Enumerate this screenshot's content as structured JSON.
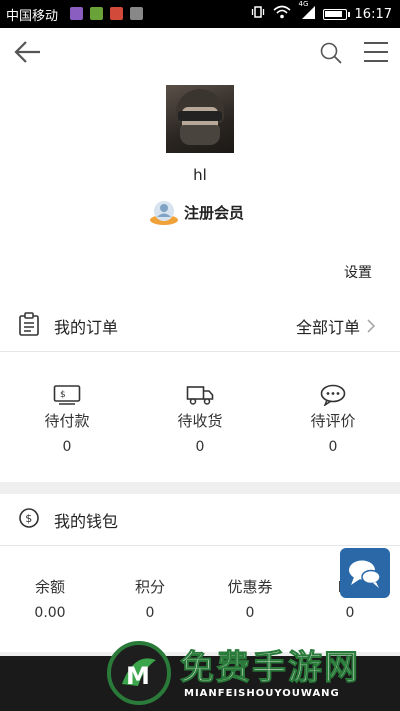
{
  "status_bar": {
    "carrier": "中国移动",
    "signal_label": "4G",
    "time": "16:17"
  },
  "profile": {
    "username": "hl",
    "member_label": "注册会员",
    "settings_label": "设置"
  },
  "orders": {
    "title": "我的订单",
    "all_label": "全部订单",
    "items": [
      {
        "label": "待付款",
        "value": "0",
        "icon": "payment-icon"
      },
      {
        "label": "待收货",
        "value": "0",
        "icon": "truck-icon"
      },
      {
        "label": "待评价",
        "value": "0",
        "icon": "comment-icon"
      }
    ]
  },
  "wallet": {
    "title": "我的钱包",
    "items": [
      {
        "label": "余额",
        "value": "0.00"
      },
      {
        "label": "积分",
        "value": "0"
      },
      {
        "label": "优惠券",
        "value": "0"
      },
      {
        "label": "K卡",
        "value": "0"
      }
    ]
  },
  "watermark": {
    "text": "免费手游网",
    "sub": "MIANFEISHOUYOUWANG"
  },
  "colors": {
    "accent_blue": "#2b68a8",
    "watermark_green": "#2a7a3a"
  }
}
